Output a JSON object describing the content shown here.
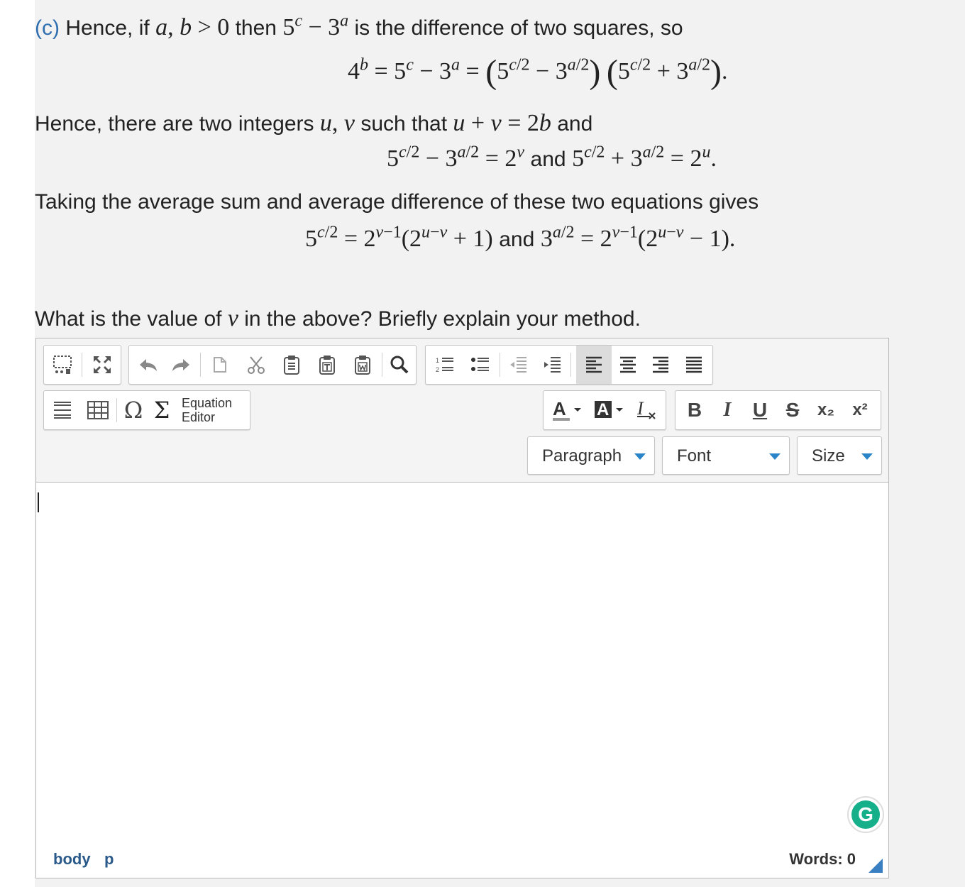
{
  "content": {
    "part_label": "(c)",
    "line1_text_a": "Hence, if",
    "line1_text_b": "then",
    "line1_text_c": "is the difference of two squares, so",
    "line2_text": "Hence, there are two integers",
    "line2_text_b": "such that",
    "line2_text_c": "and",
    "and_word": "and",
    "line3_text": "Taking the average sum and average difference of these two equations gives",
    "question": "What is the value of",
    "question_b": "in the above? Briefly explain your method."
  },
  "toolbar": {
    "row1_icons": [
      "show-blocks-icon",
      "maximize-icon",
      "undo-icon",
      "redo-icon",
      "paste-icon",
      "cut-icon",
      "copy-icon",
      "paste-text-icon",
      "paste-word-icon",
      "find-icon",
      "numbered-list-icon",
      "bulleted-list-icon",
      "outdent-icon",
      "indent-icon",
      "align-left-icon",
      "align-center-icon",
      "align-right-icon",
      "justify-icon"
    ],
    "row2_icons": [
      "horizontal-rule-icon",
      "table-icon",
      "omega-icon",
      "sigma-icon"
    ],
    "equation_editor": [
      "Equation",
      "Editor"
    ],
    "format_icons": [
      "text-color-icon",
      "background-color-icon",
      "remove-format-icon"
    ],
    "style_buttons": [
      "B",
      "I",
      "U",
      "S",
      "x₂",
      "x²"
    ],
    "paragraph_label": "Paragraph",
    "font_label": "Font",
    "size_label": "Size"
  },
  "statusbar": {
    "path": [
      "body",
      "p"
    ],
    "words": "Words: 0"
  },
  "grammarly": "G",
  "colors": {
    "accent": "#2f6fb0",
    "dropdown_arrow": "#2a84c8",
    "grammarly": "#15b08a"
  }
}
